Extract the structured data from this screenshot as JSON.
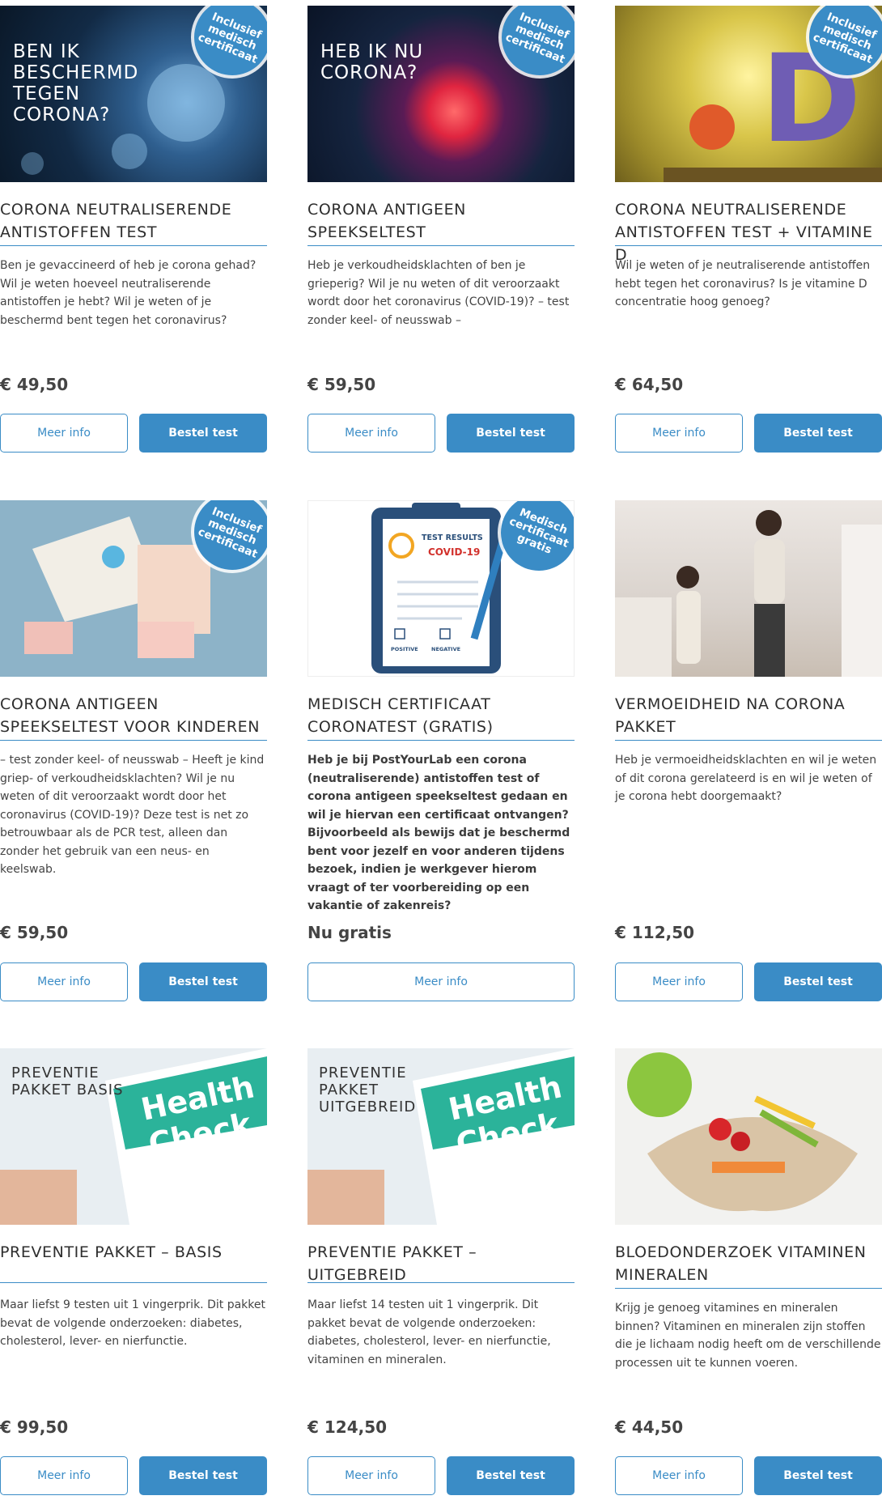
{
  "products": [
    {
      "badge": "Inclusief medisch certificaat",
      "image_text": "BEN IK BESCHERMD TEGEN CORONA?",
      "title": "CORONA NEUTRALISERENDE ANTISTOFFEN TEST",
      "description": "Ben je gevaccineerd of heb je corona gehad? Wil je weten hoeveel neutraliserende antistoffen je hebt? Wil je weten of je beschermd bent tegen het coronavirus?",
      "price": "€ 49,50",
      "more_label": "Meer info",
      "order_label": "Bestel test"
    },
    {
      "badge": "Inclusief medisch certificaat",
      "image_text": "HEB IK NU CORONA?",
      "title": "CORONA ANTIGEEN SPEEKSELTEST",
      "description": "Heb je verkoudheidsklachten of ben je grieperig? Wil je nu weten of dit veroorzaakt wordt door het coronavirus (COVID-19)? – test zonder keel- of neusswab –",
      "price": "€ 59,50",
      "more_label": "Meer info",
      "order_label": "Bestel test"
    },
    {
      "badge": "Inclusief medisch certificaat",
      "image_text": "D",
      "title": "CORONA NEUTRALISERENDE ANTISTOFFEN TEST + VITAMINE D",
      "description": "Wil je weten of je neutraliserende antistoffen hebt tegen het coronavirus? Is je vitamine D concentratie hoog genoeg?",
      "price": "€ 64,50",
      "more_label": "Meer info",
      "order_label": "Bestel test"
    },
    {
      "badge": "Inclusief medisch certificaat",
      "title": "CORONA ANTIGEEN SPEEKSELTEST VOOR KINDEREN",
      "description": "– test zonder keel- of neusswab – Heeft je kind griep- of verkoudheidsklachten? Wil je nu weten of dit veroorzaakt wordt door het coronavirus (COVID-19)?  Deze test is net zo betrouwbaar als de PCR test, alleen dan zonder het gebruik van een neus- en keelswab.",
      "price": "€ 59,50",
      "more_label": "Meer info",
      "order_label": "Bestel test"
    },
    {
      "badge": "Medisch certificaat gratis",
      "image_text": "TEST RESULTS",
      "image_text2": "COVID-19",
      "image_pos": "POSITIVE",
      "image_neg": "NEGATIVE",
      "title": "MEDISCH CERTIFICAAT CORONATEST (GRATIS)",
      "description": "Heb je bij PostYourLab een corona (neutraliserende) antistoffen test of corona antigeen speekseltest gedaan en wil je hiervan een certificaat ontvangen? Bijvoorbeeld als bewijs dat je beschermd bent voor jezelf en voor anderen tijdens bezoek, indien je werkgever hierom vraagt of ter voorbereiding op een vakantie of zakenreis?",
      "price": "Nu gratis",
      "more_label": "Meer info"
    },
    {
      "title": "VERMOEIDHEID NA CORONA PAKKET",
      "description": "Heb je vermoeidheidsklachten en wil je weten of dit corona gerelateerd is en wil je weten of je corona hebt doorgemaakt?",
      "price": "€ 112,50",
      "more_label": "Meer info",
      "order_label": "Bestel test"
    },
    {
      "image_text": "PREVENTIE PAKKET BASIS",
      "image_text2": "Health Check",
      "title": "PREVENTIE PAKKET – BASIS",
      "description": "Maar liefst 9 testen uit 1 vingerprik. Dit pakket bevat de volgende onderzoeken: diabetes, cholesterol, lever- en nierfunctie.",
      "price": "€ 99,50",
      "more_label": "Meer info",
      "order_label": "Bestel test"
    },
    {
      "image_text": "PREVENTIE PAKKET UITGEBREID",
      "image_text2": "Health Check",
      "title": "PREVENTIE PAKKET – UITGEBREID",
      "description": "Maar liefst 14 testen uit 1 vingerprik. Dit pakket bevat de volgende onderzoeken: diabetes, cholesterol, lever- en nierfunctie, vitaminen en mineralen.",
      "price": "€ 124,50",
      "more_label": "Meer info",
      "order_label": "Bestel test"
    },
    {
      "title": "BLOEDONDERZOEK VITAMINEN MINERALEN",
      "description": "Krijg je genoeg vitamines en mineralen binnen? Vitaminen en mineralen zijn stoffen die je lichaam nodig heeft om de verschillende processen uit te kunnen voeren.",
      "price": "€ 44,50",
      "more_label": "Meer info",
      "order_label": "Bestel test"
    }
  ]
}
